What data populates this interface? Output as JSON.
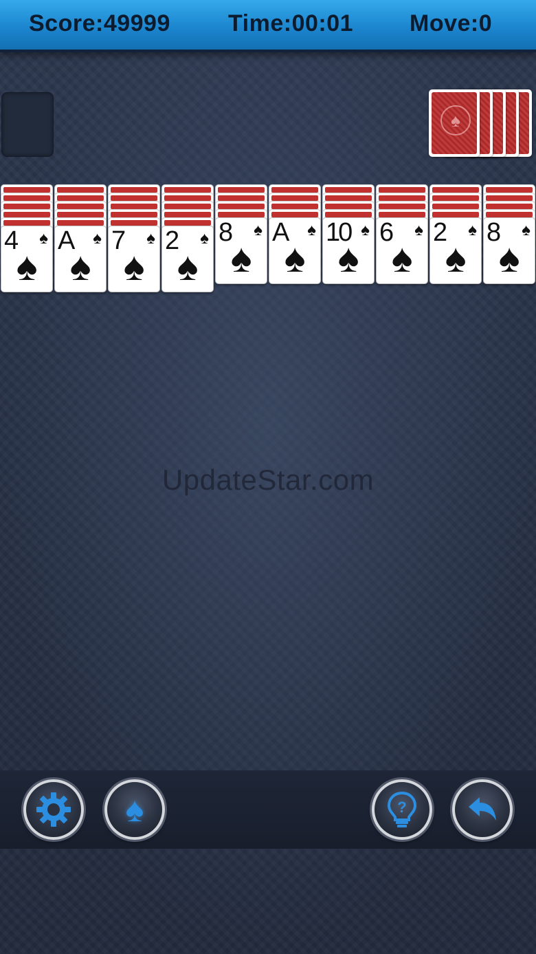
{
  "header": {
    "score": "Score:49999",
    "time": "Time:00:01",
    "moves": "Move:0"
  },
  "tableau": [
    {
      "rank": "4",
      "suit": "♠",
      "hidden": 5
    },
    {
      "rank": "A",
      "suit": "♠",
      "hidden": 5
    },
    {
      "rank": "7",
      "suit": "♠",
      "hidden": 5
    },
    {
      "rank": "2",
      "suit": "♠",
      "hidden": 5
    },
    {
      "rank": "8",
      "suit": "♠",
      "hidden": 4
    },
    {
      "rank": "A",
      "suit": "♠",
      "hidden": 4
    },
    {
      "rank": "10",
      "suit": "♠",
      "hidden": 4
    },
    {
      "rank": "6",
      "suit": "♠",
      "hidden": 4
    },
    {
      "rank": "2",
      "suit": "♠",
      "hidden": 4
    },
    {
      "rank": "8",
      "suit": "♠",
      "hidden": 4
    }
  ],
  "stock": {
    "deals_remaining": 5,
    "emblem": "♠"
  },
  "watermark": "UpdateStar.com",
  "toolbar": {
    "settings_icon": "gear-icon",
    "game_icon": "spade-icon",
    "hint_icon": "lightbulb-icon",
    "undo_icon": "undo-arrow-icon"
  },
  "colors": {
    "header": "#1c86cf",
    "card_back": "#b92c2c",
    "accent": "#2b8ee0"
  }
}
